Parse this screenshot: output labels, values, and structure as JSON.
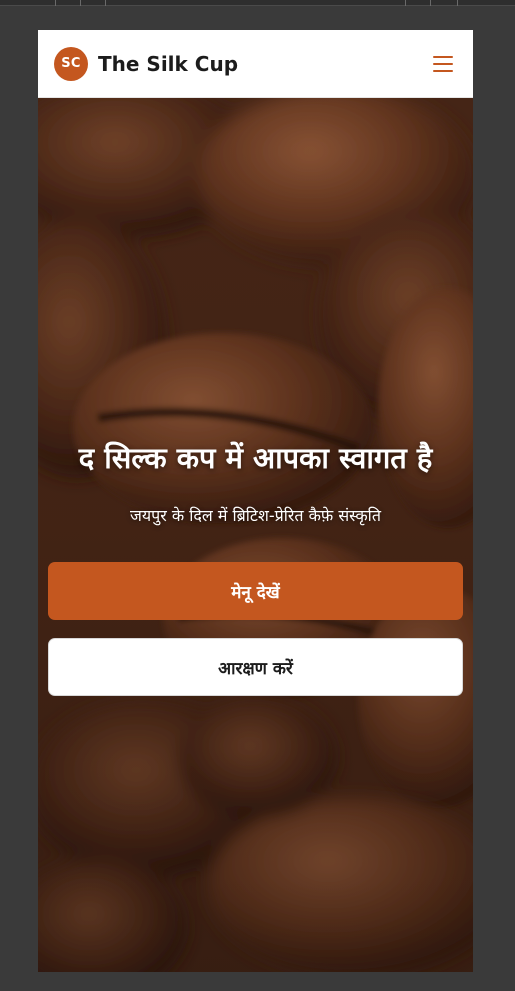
{
  "brand": {
    "logo_initials": "SC",
    "name": "The Silk Cup",
    "accent_color": "#c4571f"
  },
  "navbar": {
    "menu_icon": "hamburger-menu-icon"
  },
  "hero": {
    "background": "coffee-beans-photo",
    "title": "द सिल्क कप में आपका स्वागत है",
    "subtitle": "जयपुर के दिल में ब्रिटिश-प्रेरित कैफ़े संस्कृति",
    "primary_button": "मेनू देखें",
    "secondary_button": "आरक्षण करें"
  }
}
